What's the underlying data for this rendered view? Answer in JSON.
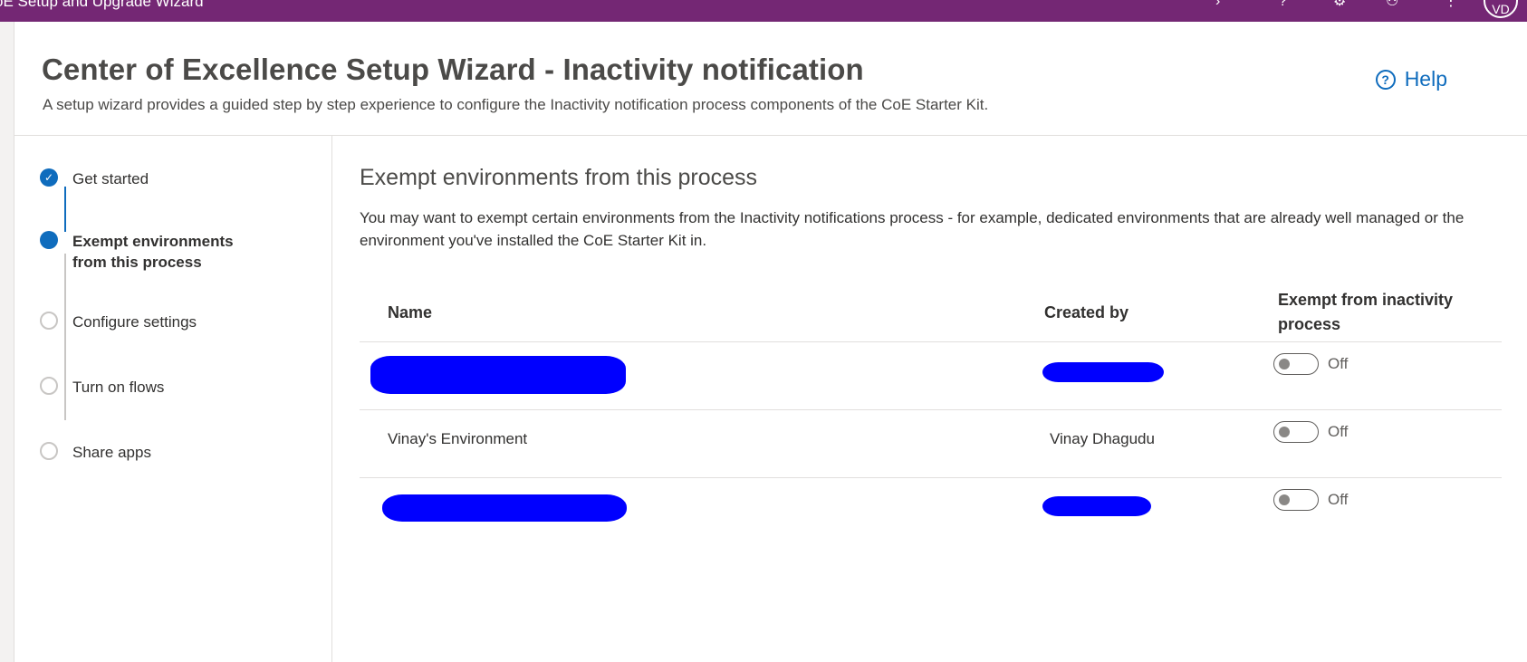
{
  "app": {
    "title": "oE Setup and Upgrade Wizard",
    "avatar_initials": "VD"
  },
  "header": {
    "title": "Center of Excellence Setup Wizard - Inactivity notification",
    "subtitle": "A setup wizard provides a guided step by step experience to configure the Inactivity notification process components of the CoE Starter Kit.",
    "help_label": "Help"
  },
  "steps": [
    {
      "label": "Get started",
      "status": "complete"
    },
    {
      "label": "Exempt environments\nfrom this process",
      "status": "current"
    },
    {
      "label": "Configure settings",
      "status": "pending"
    },
    {
      "label": "Turn on flows",
      "status": "pending"
    },
    {
      "label": "Share apps",
      "status": "pending"
    }
  ],
  "main": {
    "title": "Exempt environments from this process",
    "description": "You may want to exempt certain environments from the Inactivity notifications process - for example, dedicated environments that are already well managed or the environment you've installed the CoE Starter Kit in.",
    "table": {
      "headers": {
        "name": "Name",
        "created_by": "Created by",
        "exempt": "Exempt from inactivity process"
      },
      "rows": [
        {
          "name": "",
          "created_by": "",
          "redacted": true,
          "exempt": "Off"
        },
        {
          "name": "Vinay's Environment",
          "created_by": "Vinay Dhagudu",
          "redacted": false,
          "exempt": "Off"
        },
        {
          "name": "",
          "created_by": "",
          "redacted": true,
          "exempt": "Off"
        }
      ]
    }
  },
  "colors": {
    "topbar": "#742774",
    "accent": "#0f6cbd",
    "redaction": "#0000ff"
  }
}
